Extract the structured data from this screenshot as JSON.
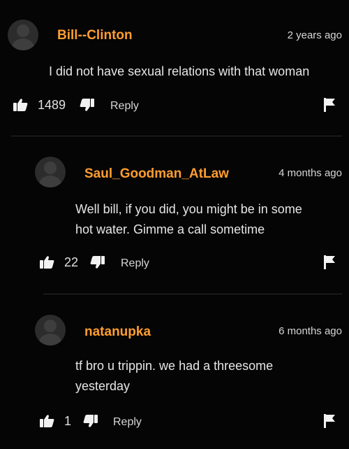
{
  "comments": [
    {
      "username": "Bill--Clinton",
      "time": "2 years ago",
      "text": "I did not have sexual relations with that woman",
      "likes": "1489",
      "reply_label": "Reply",
      "avatar_icon": "user-avatar-icon",
      "like_icon": "thumbs-up-icon",
      "dislike_icon": "thumbs-down-icon",
      "flag_icon": "flag-icon"
    },
    {
      "username": "Saul_Goodman_AtLaw",
      "time": "4 months ago",
      "text_lines": [
        "Well bill, if you did, you might be in some",
        "hot water. Gimme a call sometime"
      ],
      "likes": "22",
      "reply_label": "Reply",
      "avatar_icon": "user-avatar-icon",
      "like_icon": "thumbs-up-icon",
      "dislike_icon": "thumbs-down-icon",
      "flag_icon": "flag-icon"
    },
    {
      "username": "natanupka",
      "time": "6 months ago",
      "text_lines": [
        "tf bro u trippin. we had a threesome",
        "yesterday"
      ],
      "likes": "1",
      "reply_label": "Reply",
      "avatar_icon": "user-avatar-icon",
      "like_icon": "thumbs-up-icon",
      "dislike_icon": "thumbs-down-icon",
      "flag_icon": "flag-icon"
    }
  ],
  "colors": {
    "background": "#050505",
    "username": "#ff9d2f",
    "text": "#e6e6e6",
    "meta": "#d6d6d6"
  }
}
